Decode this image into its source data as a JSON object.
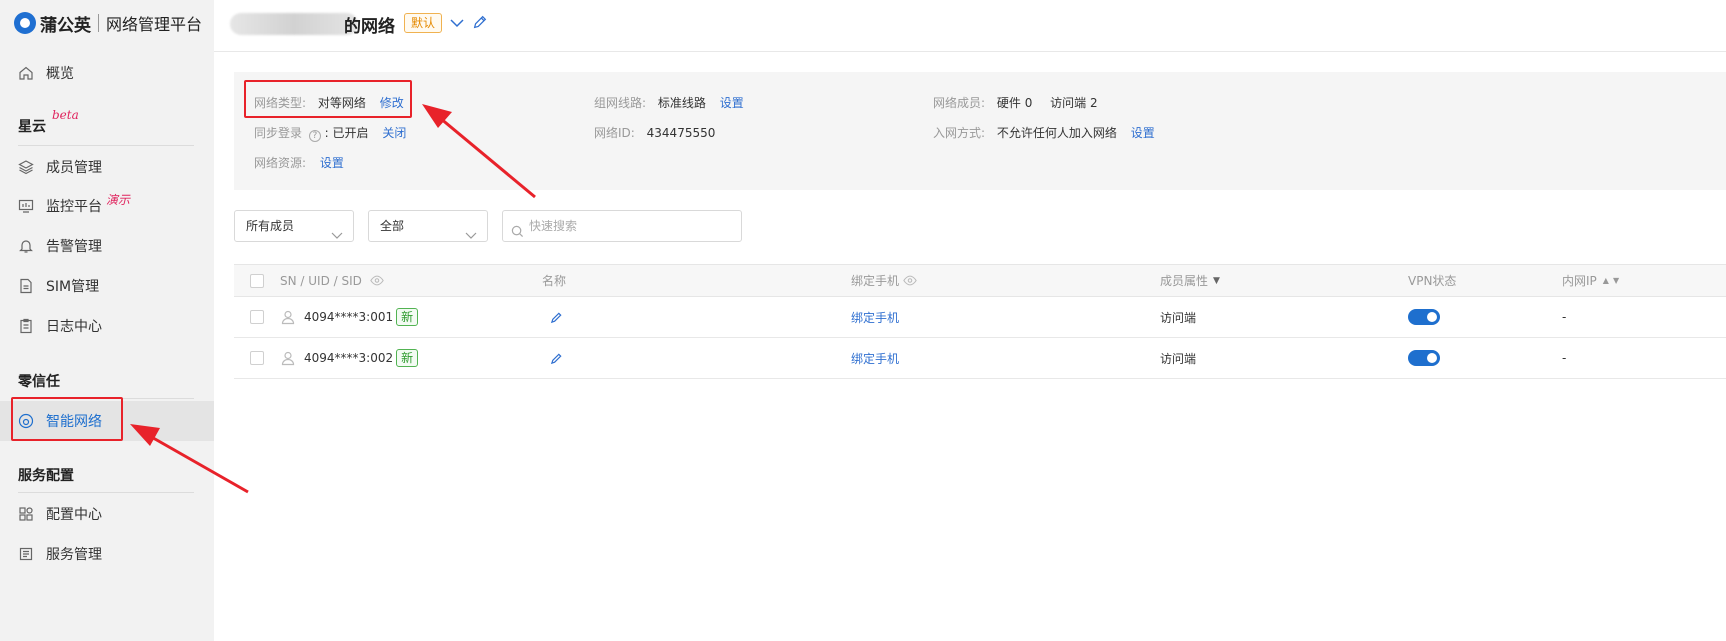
{
  "sidebar": {
    "brand": "蒲公英",
    "platform": "网络管理平台",
    "overview": "概览",
    "group_xingyun": "星云",
    "beta_tag": "beta",
    "member_mgmt": "成员管理",
    "monitor": "监控平台",
    "demo_tag": "演示",
    "alarm": "告警管理",
    "sim": "SIM管理",
    "log": "日志中心",
    "group_zero_trust": "零信任",
    "smart_network": "智能网络",
    "group_service": "服务配置",
    "config_center": "配置中心",
    "service_mgmt": "服务管理"
  },
  "header": {
    "title": "的网络",
    "default_badge": "默认"
  },
  "info": {
    "net_type_label": "网络类型:",
    "net_type_value": "对等网络",
    "net_type_action": "修改",
    "sync_login_label": "同步登录",
    "sync_login_value": ": 已开启",
    "sync_login_action": "关闭",
    "resource_label": "网络资源:",
    "resource_action": "设置",
    "route_label": "组网线路:",
    "route_value": "标准线路",
    "route_action": "设置",
    "net_id_label": "网络ID:",
    "net_id_value": "434475550",
    "members_label": "网络成员:",
    "members_hw": "硬件 0",
    "members_visitor": "访问端 2",
    "join_label": "入网方式:",
    "join_value": "不允许任何人加入网络",
    "join_action": "设置"
  },
  "filters": {
    "member_select": "所有成员",
    "status_select": "全部",
    "search_placeholder": "快速搜索"
  },
  "table": {
    "headers": {
      "sn": "SN / UID / SID",
      "name": "名称",
      "phone": "绑定手机",
      "attr": "成员属性",
      "vpn": "VPN状态",
      "ip": "内网IP"
    },
    "rows": [
      {
        "sn": "4094****3:001",
        "badge": "新",
        "phone": "绑定手机",
        "attr": "访问端",
        "ip": "-"
      },
      {
        "sn": "4094****3:002",
        "badge": "新",
        "phone": "绑定手机",
        "attr": "访问端",
        "ip": "-"
      }
    ]
  },
  "colors": {
    "accent": "#1e6fce",
    "highlight": "#e8222a",
    "default_badge": "#e58a00",
    "new_badge": "#2e9b2e"
  }
}
